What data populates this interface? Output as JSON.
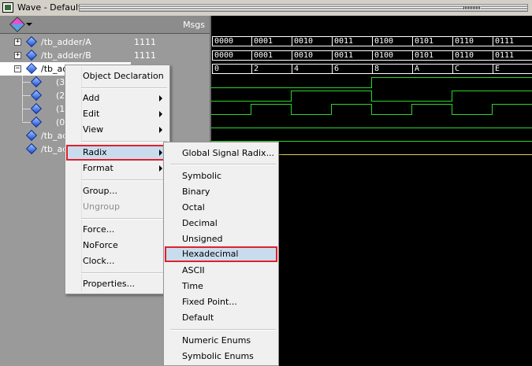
{
  "window": {
    "title": "Wave - Default"
  },
  "header": {
    "msgs_label": "Msgs",
    "icon": "wave-palette-icon"
  },
  "signals": [
    {
      "name": "/tb_adder/A",
      "value": "1111",
      "expander": "+"
    },
    {
      "name": "/tb_adder/B",
      "value": "1111",
      "expander": "+"
    },
    {
      "name": "/tb_ad",
      "value": "",
      "expander": "−"
    },
    {
      "name": "(3",
      "value": ""
    },
    {
      "name": "(2",
      "value": ""
    },
    {
      "name": "(1",
      "value": ""
    },
    {
      "name": "(0",
      "value": ""
    },
    {
      "name": "/tb_ad",
      "value": ""
    },
    {
      "name": "/tb_ad",
      "value": ""
    }
  ],
  "bus_a": [
    "0000",
    "0001",
    "0010",
    "0011",
    "0100",
    "0101",
    "0110",
    "0111"
  ],
  "bus_b": [
    "0000",
    "0001",
    "0010",
    "0011",
    "0100",
    "0101",
    "0110",
    "0111"
  ],
  "bus_sum": [
    "0",
    "2",
    "4",
    "6",
    "8",
    "A",
    "C",
    "E"
  ],
  "context_menu": {
    "object_declaration": "Object Declaration",
    "add": "Add",
    "edit": "Edit",
    "view": "View",
    "radix": "Radix",
    "format": "Format",
    "group": "Group...",
    "ungroup": "Ungroup",
    "force": "Force...",
    "noforce": "NoForce",
    "clock": "Clock...",
    "properties": "Properties..."
  },
  "radix_menu": {
    "global": "Global Signal Radix...",
    "symbolic": "Symbolic",
    "binary": "Binary",
    "octal": "Octal",
    "decimal": "Decimal",
    "unsigned": "Unsigned",
    "hexadecimal": "Hexadecimal",
    "ascii": "ASCII",
    "time": "Time",
    "fixed_point": "Fixed Point...",
    "default": "Default",
    "numeric_enums": "Numeric Enums",
    "symbolic_enums": "Symbolic Enums"
  },
  "colors": {
    "highlight_border": "#e0202a",
    "wave_green": "#2ad62a",
    "bus_white": "#ffffff",
    "cursor_yellow": "#f0e060"
  }
}
